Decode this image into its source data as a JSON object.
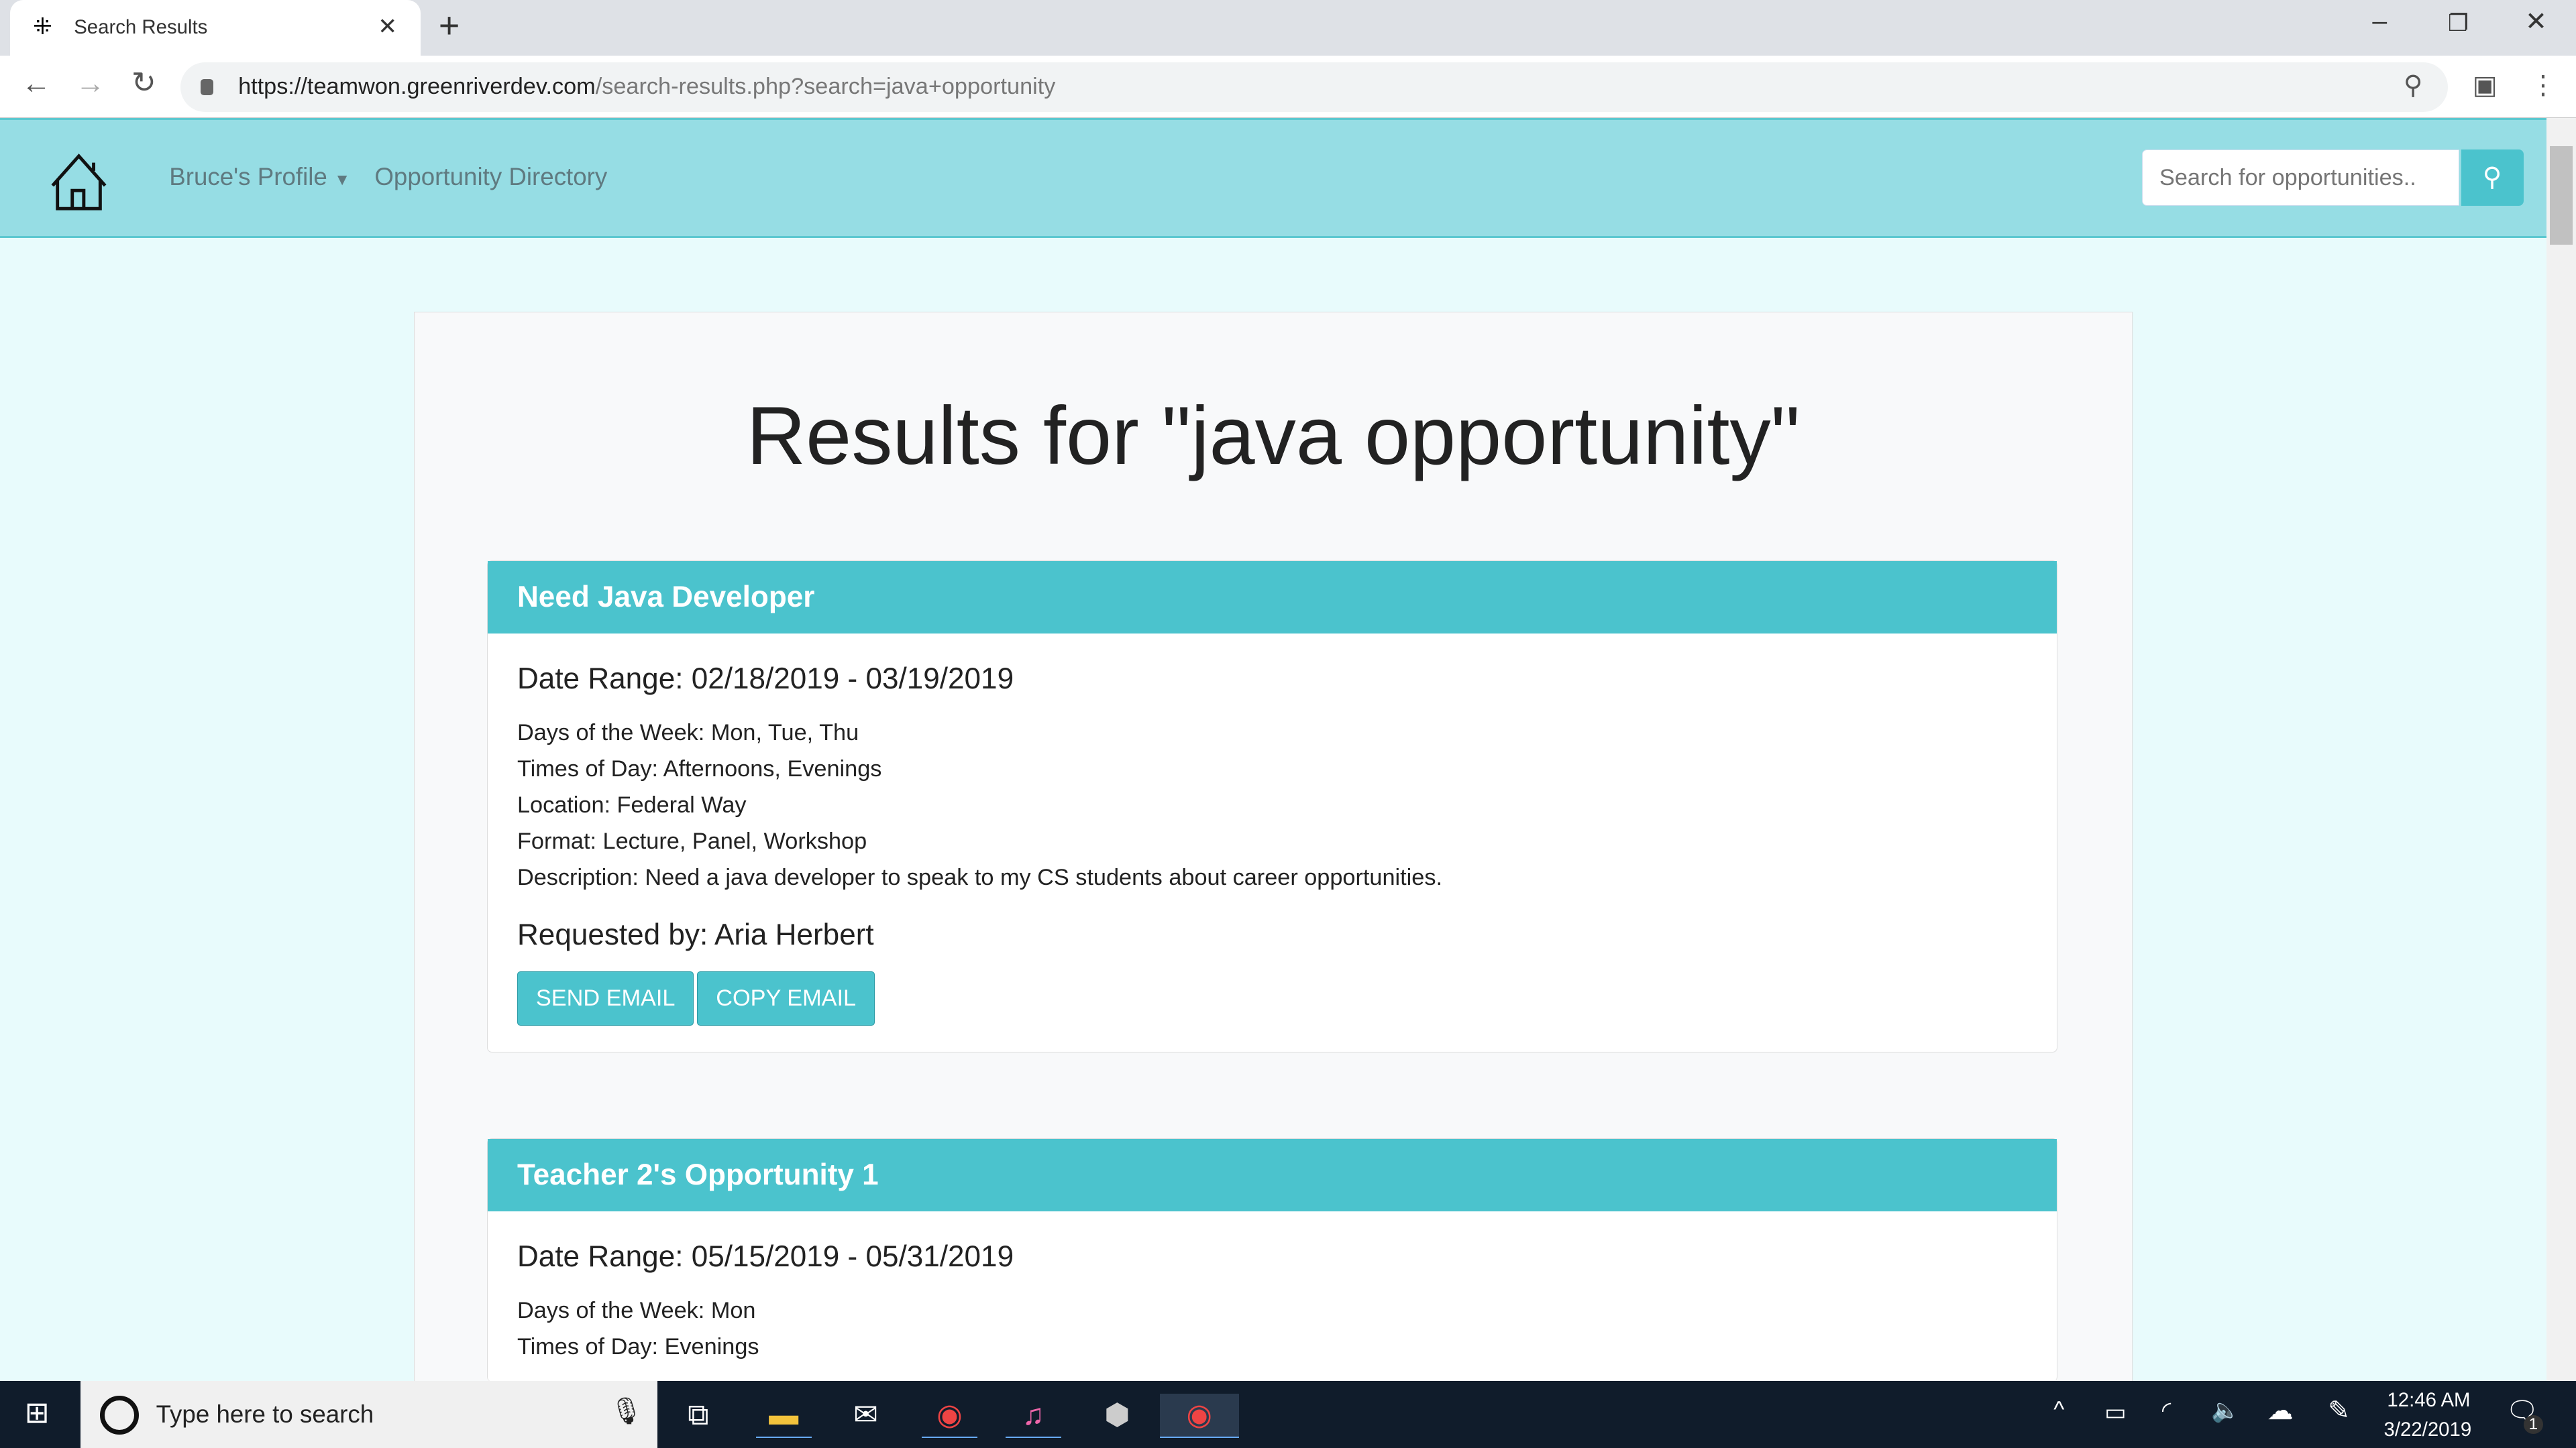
{
  "browser": {
    "tab_title": "Search Results",
    "url_host": "https://teamwon.greenriverdev.com",
    "url_path": "/search-results.php?search=java+opportunity"
  },
  "nav": {
    "profile": "Bruce's Profile",
    "directory": "Opportunity Directory",
    "search_placeholder": "Search for opportunities.."
  },
  "page": {
    "title": "Results for \"java opportunity\""
  },
  "results": [
    {
      "title": "Need Java Developer",
      "date_range": "Date Range: 02/18/2019 - 03/19/2019",
      "days": "Days of the Week: Mon, Tue, Thu",
      "times": "Times of Day: Afternoons, Evenings",
      "location": "Location: Federal Way",
      "format": "Format: Lecture, Panel, Workshop",
      "description": "Description: Need a java developer to speak to my CS students about career opportunities.",
      "requested_by": "Requested by: Aria Herbert",
      "send_email": "SEND EMAIL",
      "copy_email": "COPY EMAIL"
    },
    {
      "title": "Teacher 2's Opportunity 1",
      "date_range": "Date Range: 05/15/2019 - 05/31/2019",
      "days": "Days of the Week: Mon",
      "times": "Times of Day: Evenings"
    }
  ],
  "taskbar": {
    "search_placeholder": "Type here to search",
    "time": "12:46 AM",
    "date": "3/22/2019",
    "notifications": "1"
  }
}
